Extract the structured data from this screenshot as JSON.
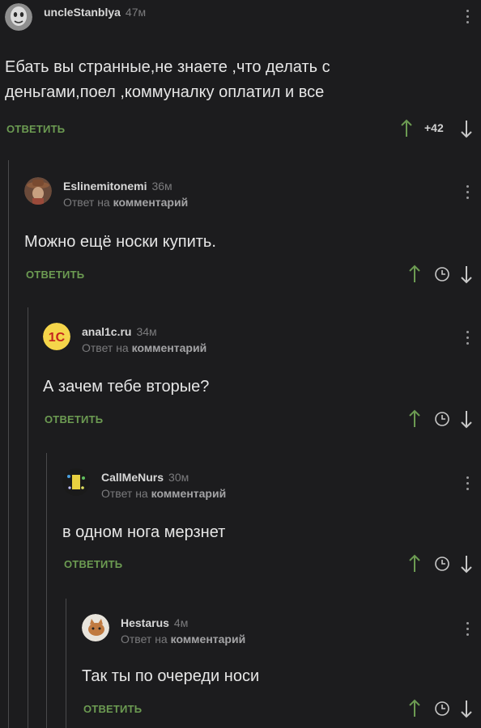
{
  "comments": [
    {
      "author": "uncleStanblya",
      "time": "47м",
      "reply_prefix": "",
      "reply_link": "",
      "text_lines": [
        "Ебать вы странные,не знаете ,что делать с",
        "деньгами,поел ,коммуналку оплатил и все"
      ],
      "reply_label": "ОТВЕТИТЬ",
      "score": "+42",
      "avatar": "mask-avatar"
    },
    {
      "author": "Eslinemitonemi",
      "time": "36м",
      "reply_prefix": "Ответ на",
      "reply_link": "комментарий",
      "text_lines": [
        "Можно ещё носки купить."
      ],
      "reply_label": "ОТВЕТИТЬ",
      "avatar": "cowboy-avatar"
    },
    {
      "author": "anal1c.ru",
      "time": "34м",
      "reply_prefix": "Ответ на",
      "reply_link": "комментарий",
      "text_lines": [
        "А зачем тебе вторые?"
      ],
      "reply_label": "ОТВЕТИТЬ",
      "avatar": "1c-logo-avatar"
    },
    {
      "author": "CallMeNurs",
      "time": "30м",
      "reply_prefix": "Ответ на",
      "reply_link": "комментарий",
      "text_lines": [
        "в одном нога мерзнет"
      ],
      "reply_label": "ОТВЕТИТЬ",
      "avatar": "glitter-avatar"
    },
    {
      "author": "Hestarus",
      "time": "4м",
      "reply_prefix": "Ответ на",
      "reply_link": "комментарий",
      "text_lines": [
        "Так ты по очереди носи"
      ],
      "reply_label": "ОТВЕТИТЬ",
      "avatar": "cat-avatar"
    }
  ],
  "colors": {
    "background": "#1c1c1e",
    "reply_green": "#6c9b52",
    "upvote_green": "#6c9b52",
    "text": "#e6e6e6",
    "muted": "#7b7b7d"
  },
  "icons": {
    "upvote": "arrow-up-icon",
    "downvote": "arrow-down-icon",
    "save": "clock-icon",
    "more": "vertical-dots-icon"
  }
}
